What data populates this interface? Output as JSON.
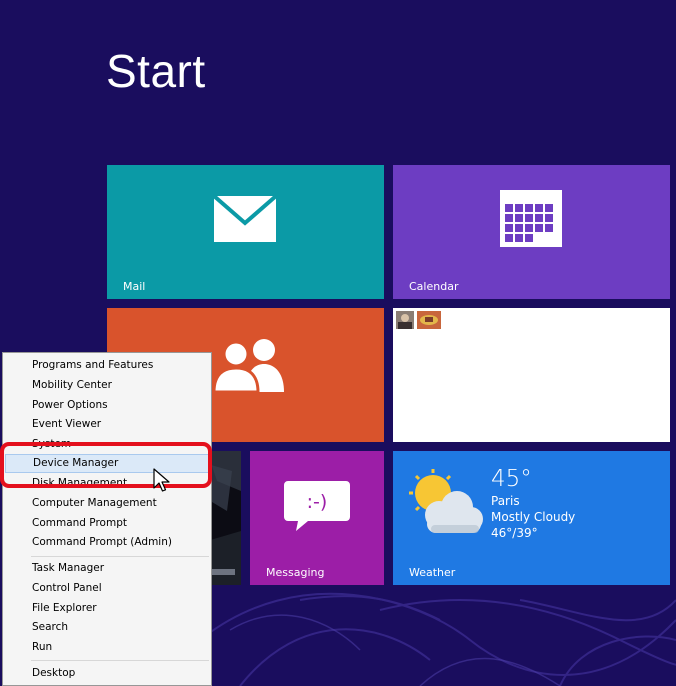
{
  "start": {
    "title": "Start"
  },
  "tiles": {
    "mail": {
      "label": "Mail",
      "color": "#0b9aa6"
    },
    "calendar": {
      "label": "Calendar",
      "color": "#6d3dc2"
    },
    "people": {
      "color": "#d9532c"
    },
    "photos": {
      "color": "#ffffff"
    },
    "games": {
      "color": "#0c0c14"
    },
    "messaging": {
      "label": "Messaging",
      "color": "#9c1ea7"
    },
    "weather": {
      "label": "Weather",
      "temp": "45°",
      "city": "Paris",
      "condition": "Mostly Cloudy",
      "range": "46°/39°",
      "color": "#1f79e3"
    }
  },
  "context_menu": {
    "items": [
      {
        "label": "Programs and Features"
      },
      {
        "label": "Mobility Center"
      },
      {
        "label": "Power Options"
      },
      {
        "label": "Event Viewer"
      },
      {
        "label": "System"
      },
      {
        "label": "Device Manager",
        "state": "hover"
      },
      {
        "label": "Disk Management"
      },
      {
        "label": "Computer Management"
      },
      {
        "label": "Command Prompt"
      },
      {
        "label": "Command Prompt (Admin)"
      },
      {
        "label": "Task Manager"
      },
      {
        "label": "Control Panel"
      },
      {
        "label": "File Explorer"
      },
      {
        "label": "Search"
      },
      {
        "label": "Run"
      },
      {
        "label": "Desktop"
      }
    ],
    "highlight_color": "#e4101d"
  },
  "colors": {
    "background": "#1a0d5e"
  }
}
